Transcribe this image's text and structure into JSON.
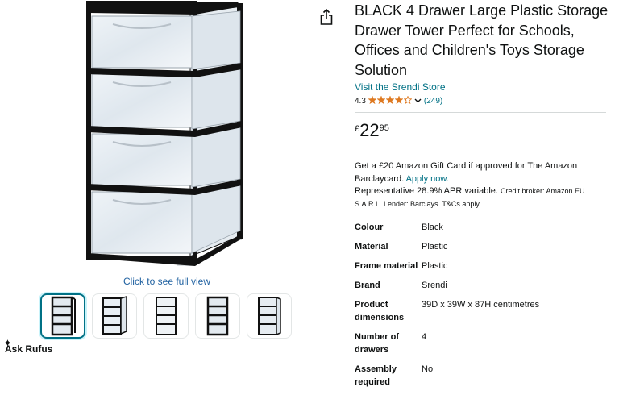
{
  "product": {
    "title": "BLACK 4 Drawer Large Plastic Storage Drawer Tower Perfect for Schools, Offices and Children's Toys Storage Solution",
    "store_link": "Visit the Srendi Store",
    "rating_value": "4.3",
    "rating_stars": 4.3,
    "rating_count": "(249)",
    "price": {
      "symbol": "£",
      "whole": "22",
      "fraction": "95"
    },
    "offer": {
      "text": "Get a £20 Amazon Gift Card if approved for The Amazon Barclaycard.",
      "link": "Apply now.",
      "apr_text": "Representative 28.9% APR variable.",
      "broker_text": "Credit broker: Amazon EU S.A.R.L. Lender: Barclays. T&Cs apply."
    },
    "specs": [
      {
        "label": "Colour",
        "value": "Black"
      },
      {
        "label": "Material",
        "value": "Plastic"
      },
      {
        "label": "Frame material",
        "value": "Plastic"
      },
      {
        "label": "Brand",
        "value": "Srendi"
      },
      {
        "label": "Product dimensions",
        "value": "39D x 39W x 87H centimetres"
      },
      {
        "label": "Number of drawers",
        "value": "4"
      },
      {
        "label": "Assembly required",
        "value": "No"
      }
    ]
  },
  "gallery": {
    "click_full": "Click to see full view",
    "thumbnail_count": 5,
    "selected_index": 0
  },
  "rufus": {
    "label": "Ask Rufus",
    "icon": "sparkle-icon"
  },
  "share": {
    "icon": "share-icon"
  },
  "colors": {
    "link": "#007185",
    "star": "#de7921",
    "selected_border": "#007185",
    "frame": "#111111"
  }
}
